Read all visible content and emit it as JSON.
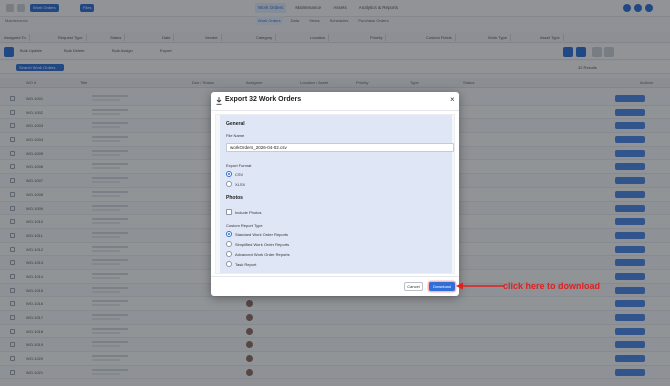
{
  "app": {
    "top_button": "Work Orders",
    "top_button_2": "Files",
    "app_name": "Maintenance",
    "main_nav": [
      "Work Orders",
      "Maintenance",
      "Assets",
      "Analytics & Reports"
    ],
    "sub_nav": [
      "Work Orders",
      "Data",
      "Views",
      "Schedules",
      "Purchase Orders"
    ],
    "filters": [
      "Assigned To",
      "Request Type",
      "Status",
      "Date",
      "Vendor",
      "Category",
      "Location",
      "Priority",
      "Custom Fields",
      "Work Type",
      "Asset Type"
    ],
    "tools": [
      "Bulk Update",
      "Bulk Delete",
      "Bulk Assign",
      "Export"
    ],
    "search_placeholder": "Search Work Orders",
    "results_label": "32 Results",
    "table_headers": [
      "WO #",
      "Title",
      "Due / Status",
      "Assignee",
      "Location / Asset",
      "Priority",
      "Type",
      "Status",
      "Actions"
    ]
  },
  "rows": [
    {
      "wo": "WO-1001",
      "status": "",
      "status_color": ""
    },
    {
      "wo": "WO-1002",
      "status": "",
      "status_color": ""
    },
    {
      "wo": "WO-1003",
      "status": "",
      "status_color": ""
    },
    {
      "wo": "WO-1004",
      "status": "",
      "status_color": ""
    },
    {
      "wo": "WO-1005",
      "status": "",
      "status_color": ""
    },
    {
      "wo": "WO-1006",
      "status": "",
      "status_color": ""
    },
    {
      "wo": "WO-1007",
      "status": "",
      "status_color": ""
    },
    {
      "wo": "WO-1008",
      "status": "",
      "status_color": ""
    },
    {
      "wo": "WO-1009",
      "status": "",
      "status_color": ""
    },
    {
      "wo": "WO-1010",
      "status": "",
      "status_color": ""
    },
    {
      "wo": "WO-1011",
      "status": "",
      "status_color": ""
    },
    {
      "wo": "WO-1012",
      "status": "",
      "status_color": ""
    },
    {
      "wo": "WO-1013",
      "status": "",
      "status_color": ""
    },
    {
      "wo": "WO-1014",
      "status": "",
      "status_color": ""
    },
    {
      "wo": "WO-1015",
      "status": "",
      "status_color": ""
    },
    {
      "wo": "WO-1016",
      "status": "",
      "status_color": ""
    },
    {
      "wo": "WO-1017",
      "status": "",
      "status_color": ""
    },
    {
      "wo": "WO-1018",
      "status": "",
      "status_color": ""
    },
    {
      "wo": "WO-1019",
      "status": "",
      "status_color": ""
    },
    {
      "wo": "WO-1020",
      "status": "",
      "status_color": ""
    },
    {
      "wo": "WO-1021",
      "status": "",
      "status_color": ""
    }
  ],
  "modal": {
    "title": "Export 32 Work Orders",
    "close_symbol": "×",
    "general_title": "General",
    "file_name_label": "File Name",
    "file_name_value": "workOrders_2026-04-02.csv",
    "export_format_label": "Export Format",
    "format_options": [
      "CSV",
      "XLSX"
    ],
    "selected_format": "CSV",
    "photos_title": "Photos",
    "include_photos_label": "Include Photos",
    "custom_report_label": "Custom Report Type",
    "report_options": [
      "Standard Work Order Reports",
      "Simplified Work Order Reports",
      "Advanced Work Order Reports",
      "Task Report"
    ],
    "selected_report": "Standard Work Order Reports",
    "cancel_label": "Cancel",
    "download_label": "Download"
  },
  "annotation": {
    "text": "click here to download",
    "color": "#e02020"
  },
  "colors": {
    "accent": "#2f6fd6",
    "panel_bg": "#dfe7f6"
  }
}
